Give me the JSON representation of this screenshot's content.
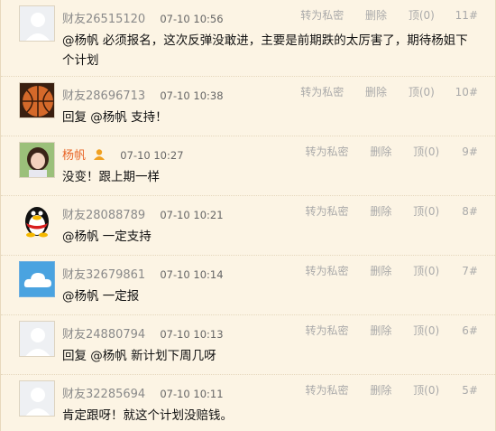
{
  "actions": {
    "private_msg": "转为私密",
    "delete": "删除"
  },
  "comments": [
    {
      "user": "财友26515120",
      "time": "07-10 10:56",
      "up": "顶(0)",
      "floor": "11#",
      "text": "@杨帆 必须报名，这次反弹没敢进，主要是前期跌的太厉害了，期待杨姐下个计划",
      "avatar": "default-avatar-icon"
    },
    {
      "user": "财友28696713",
      "time": "07-10 10:38",
      "up": "顶(0)",
      "floor": "10#",
      "text": "回复 @杨帆 支持！",
      "avatar": "basketball-photo-avatar"
    },
    {
      "user": "杨帆",
      "time": "07-10 10:27",
      "up": "顶(0)",
      "floor": "9#",
      "text": "没变！跟上期一样",
      "avatar": "girl-photo-avatar",
      "vip": true
    },
    {
      "user": "财友28088789",
      "time": "07-10 10:21",
      "up": "顶(0)",
      "floor": "8#",
      "text": "@杨帆 一定支持",
      "avatar": "qq-penguin-avatar"
    },
    {
      "user": "财友32679861",
      "time": "07-10 10:14",
      "up": "顶(0)",
      "floor": "7#",
      "text": "@杨帆 一定报",
      "avatar": "cloud-avatar"
    },
    {
      "user": "财友24880794",
      "time": "07-10 10:13",
      "up": "顶(0)",
      "floor": "6#",
      "text": "回复 @杨帆 新计划下周几呀",
      "avatar": "default-avatar-icon"
    },
    {
      "user": "财友32285694",
      "time": "07-10 10:11",
      "up": "顶(0)",
      "floor": "5#",
      "text": "肯定跟呀！就这个计划没赔钱。",
      "avatar": "default-avatar-icon"
    }
  ]
}
